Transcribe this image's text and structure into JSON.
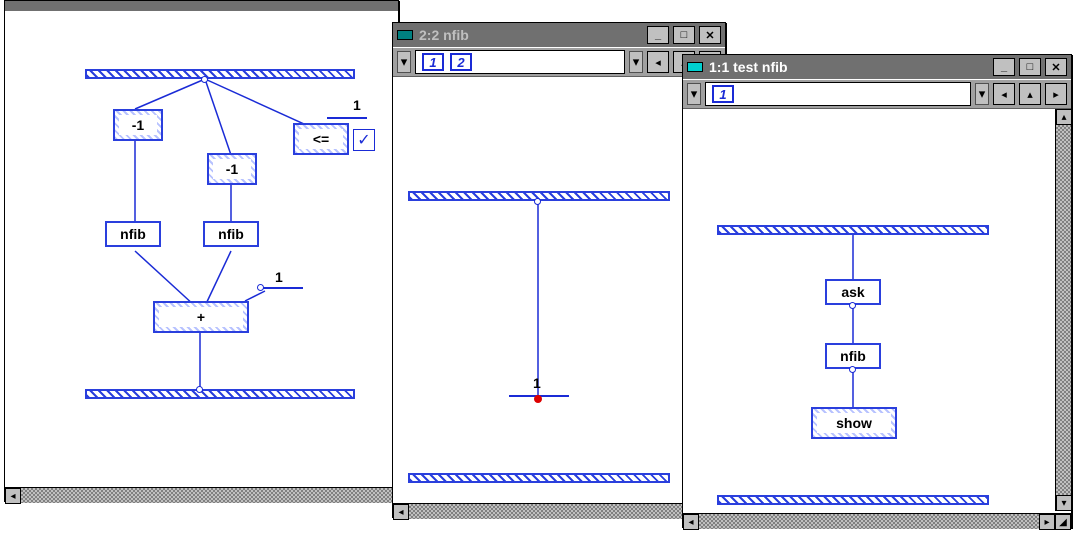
{
  "windows": {
    "w1": {
      "nodes": {
        "minus1a": "-1",
        "minus1b": "-1",
        "nfibL": "nfib",
        "nfibR": "nfib",
        "plus": "+",
        "le": "<="
      },
      "constants": {
        "top": "1",
        "mid": "1"
      }
    },
    "w2": {
      "title": "2:2 nfib",
      "toolbar": {
        "chips": [
          "1",
          "2"
        ]
      },
      "constants": {
        "center": "1"
      }
    },
    "w3": {
      "title": "1:1 test nfib",
      "toolbar": {
        "chips": [
          "1"
        ]
      },
      "nodes": {
        "ask": "ask",
        "nfib": "nfib",
        "show": "show"
      }
    }
  }
}
